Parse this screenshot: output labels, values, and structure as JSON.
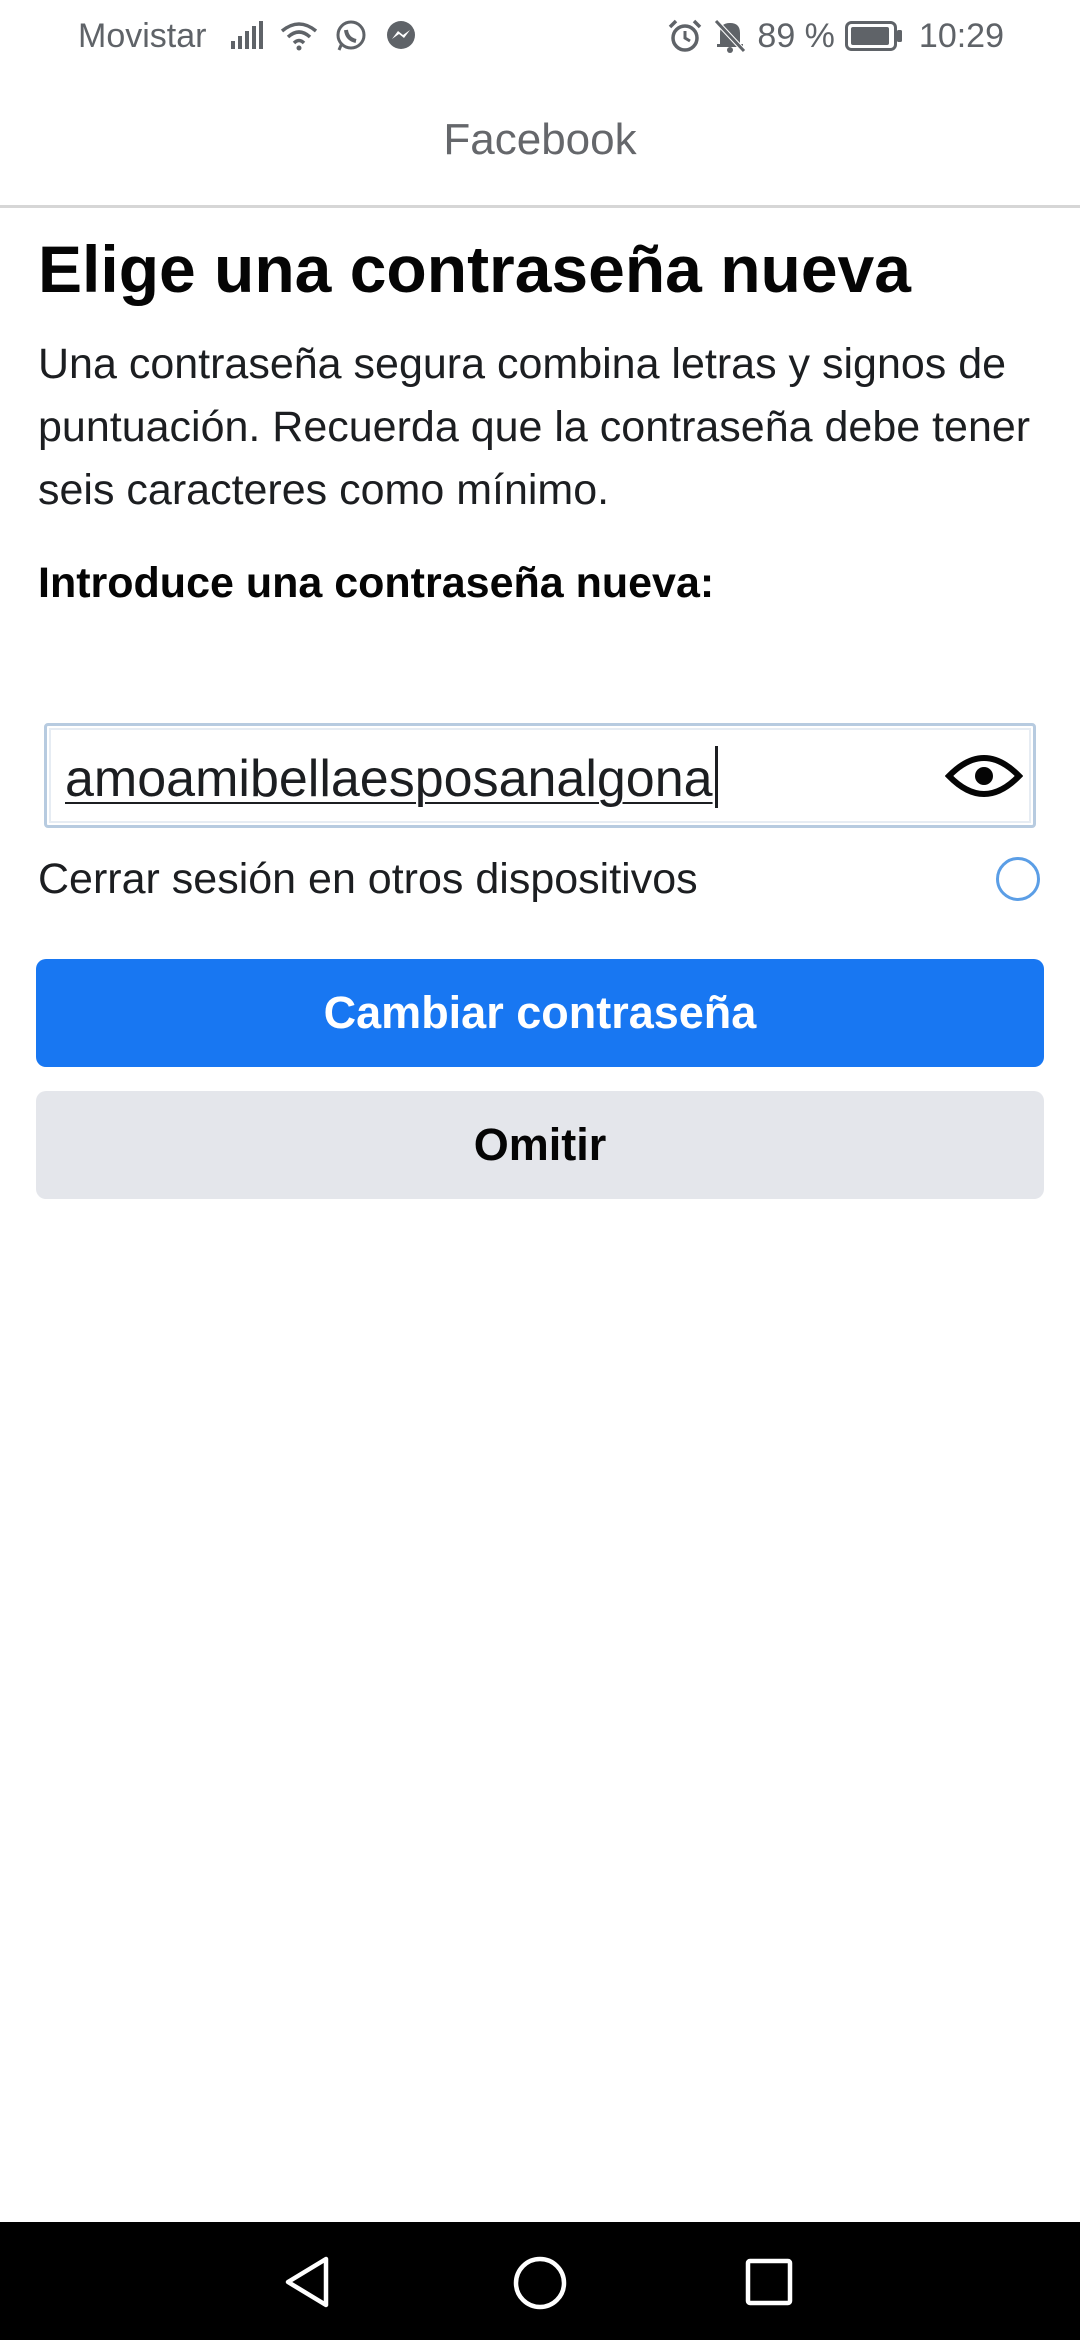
{
  "status_bar": {
    "carrier": "Movistar",
    "battery_percent": "89 %",
    "time": "10:29",
    "icons": [
      "signal-icon",
      "wifi-icon",
      "whatsapp-icon",
      "messenger-icon",
      "alarm-icon",
      "bell-off-icon",
      "battery-icon"
    ]
  },
  "header": {
    "title": "Facebook"
  },
  "main": {
    "title": "Elige una contraseña nueva",
    "description": "Una contraseña segura combina letras y signos de puntuación. Recuerda que la contraseña debe tener seis caracteres como mínimo.",
    "field_label": "Introduce una contraseña nueva:",
    "password_value": "amoamibellaesposanalgona",
    "show_password_icon": "eye-icon",
    "logout_label": "Cerrar sesión en otros dispositivos",
    "logout_checked": false,
    "primary_button": "Cambiar contraseña",
    "secondary_button": "Omitir"
  },
  "colors": {
    "primary": "#1877f2",
    "secondary_bg": "#e4e6eb",
    "radio": "#5b9ee6"
  },
  "nav_bar": {
    "icons": [
      "back-icon",
      "home-icon",
      "recents-icon"
    ]
  }
}
